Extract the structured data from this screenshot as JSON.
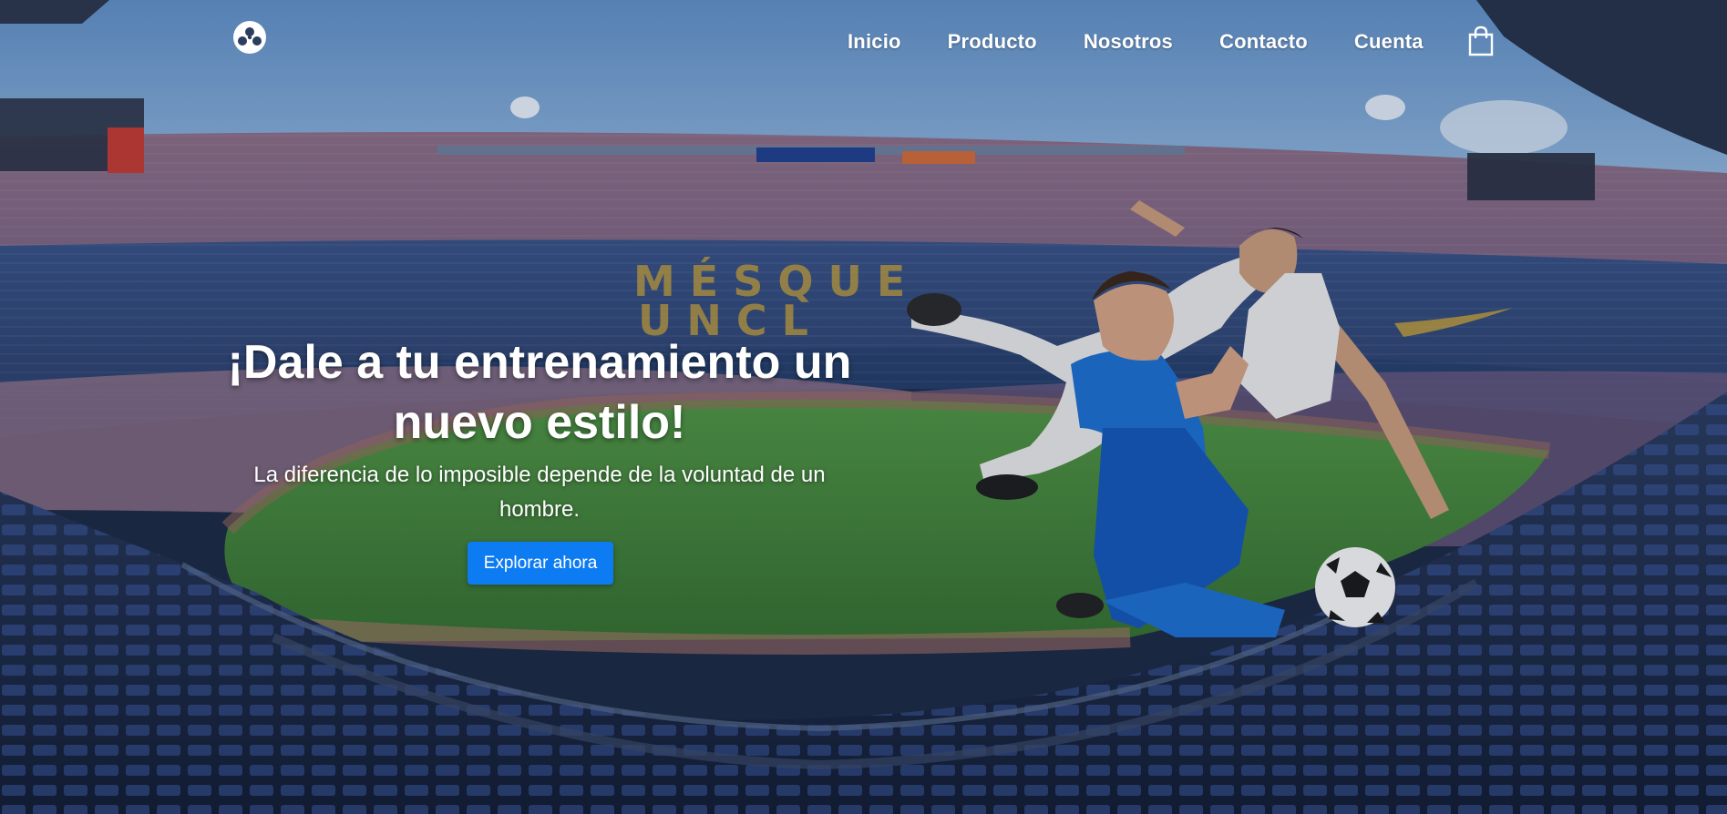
{
  "nav": {
    "links": [
      {
        "label": "Inicio"
      },
      {
        "label": "Producto"
      },
      {
        "label": "Nosotros"
      },
      {
        "label": "Contacto"
      },
      {
        "label": "Cuenta"
      }
    ],
    "logo_icon": "soccer-ball-icon",
    "cart_icon": "shopping-bag-icon"
  },
  "hero": {
    "headline": "¡Dale a tu entrenamiento un nuevo estilo!",
    "subtitle": "La diferencia de lo imposible depende de la voluntad de un hombre.",
    "cta_label": "Explorar ahora",
    "stadium_banner_text": "MÉS QUE UN CL",
    "background_image": "stadium-with-soccer-players-photo"
  },
  "colors": {
    "cta": "#0d7cf2",
    "nav_text": "#ffffff",
    "pitch": "#3f8a3a",
    "sky": "#6f9ed0"
  }
}
